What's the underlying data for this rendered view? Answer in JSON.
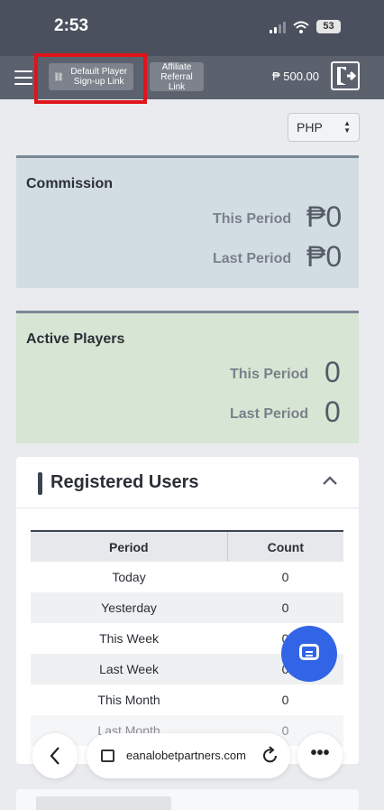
{
  "status_bar": {
    "time": "2:53",
    "battery": "53"
  },
  "navbar": {
    "default_player_link": "Default Player Sign-up Link",
    "affiliate_referral_link": "Affiliate Referral Link",
    "balance": "₱ 500.00",
    "icons": {
      "menu": "hamburger-icon",
      "link": "link-icon",
      "logout": "logout-icon"
    }
  },
  "currency": {
    "selected": "PHP"
  },
  "commission": {
    "title": "Commission",
    "this_period_label": "This Period",
    "this_period_value": "₱0",
    "last_period_label": "Last Period",
    "last_period_value": "₱0"
  },
  "active_players": {
    "title": "Active Players",
    "this_period_label": "This Period",
    "this_period_value": "0",
    "last_period_label": "Last Period",
    "last_period_value": "0"
  },
  "registered_users": {
    "title": "Registered Users",
    "columns": [
      "Period",
      "Count"
    ],
    "rows": [
      {
        "period": "Today",
        "count": "0"
      },
      {
        "period": "Yesterday",
        "count": "0"
      },
      {
        "period": "This Week",
        "count": "0"
      },
      {
        "period": "Last Week",
        "count": "0"
      },
      {
        "period": "This Month",
        "count": "0"
      },
      {
        "period": "Last Month",
        "count": "0"
      }
    ]
  },
  "browser": {
    "url": "eanalobetpartners.com"
  },
  "colors": {
    "navbar": "#5b616d",
    "status_bar": "#4a505e",
    "highlight_outline": "#e0141b",
    "commission_bg": "#d2dde3",
    "players_bg": "#d7e6d4",
    "chat_button": "#3264e6"
  }
}
